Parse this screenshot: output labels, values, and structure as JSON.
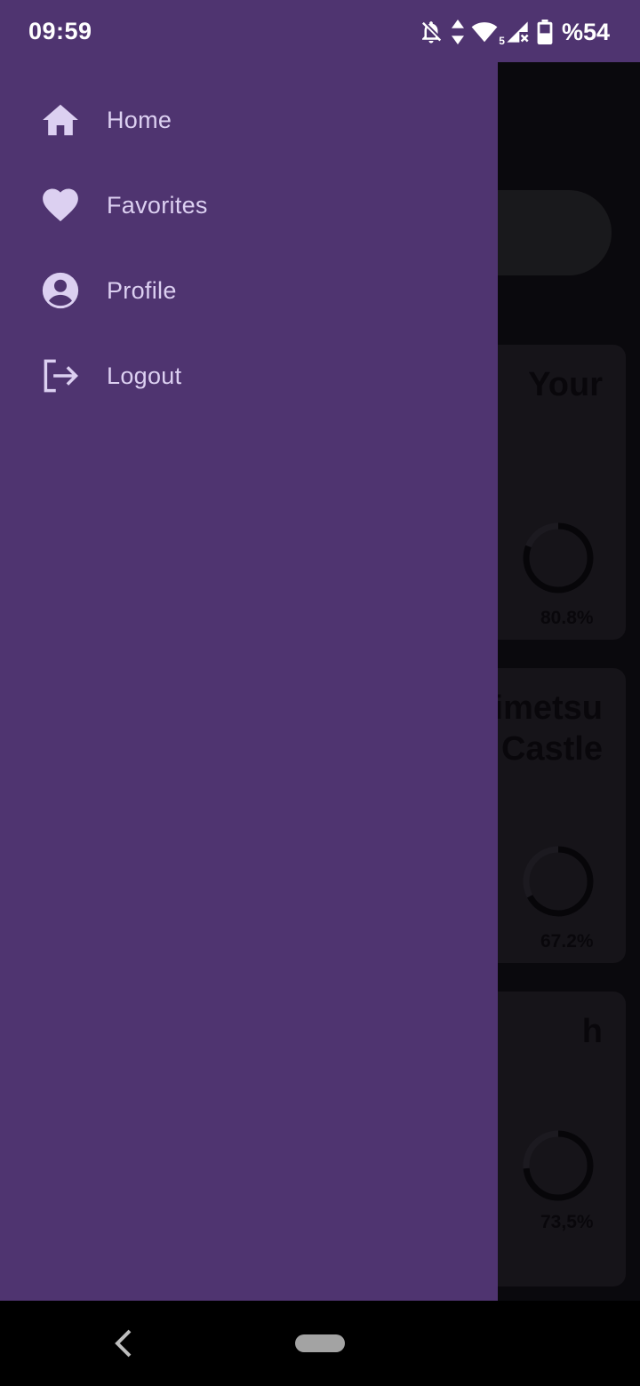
{
  "status_bar": {
    "time": "09:59",
    "battery_percent": "%54",
    "icons": [
      "notifications-off-icon",
      "data-arrows-icon",
      "wifi-icon",
      "signal-no-service-icon",
      "battery-icon"
    ],
    "wifi_badge": "5"
  },
  "drawer": {
    "items": [
      {
        "label": "Home",
        "icon": "home-icon"
      },
      {
        "label": "Favorites",
        "icon": "heart-icon"
      },
      {
        "label": "Profile",
        "icon": "account-circle-icon"
      },
      {
        "label": "Logout",
        "icon": "logout-icon"
      }
    ]
  },
  "background_app": {
    "cards": [
      {
        "title_fragment": "Your",
        "percent": "80.8%",
        "progress": 0.808
      },
      {
        "title_fragment": "imetsu\nCastle",
        "percent": "67.2%",
        "progress": 0.672
      },
      {
        "title_fragment": "h",
        "percent": "73,5%",
        "progress": 0.735
      }
    ]
  },
  "colors": {
    "drawer": "#4f3470",
    "drawer_text": "#dcd0f1",
    "background": "#121016"
  },
  "nav_bar": {
    "icons": [
      "back-icon",
      "home-pill"
    ]
  }
}
